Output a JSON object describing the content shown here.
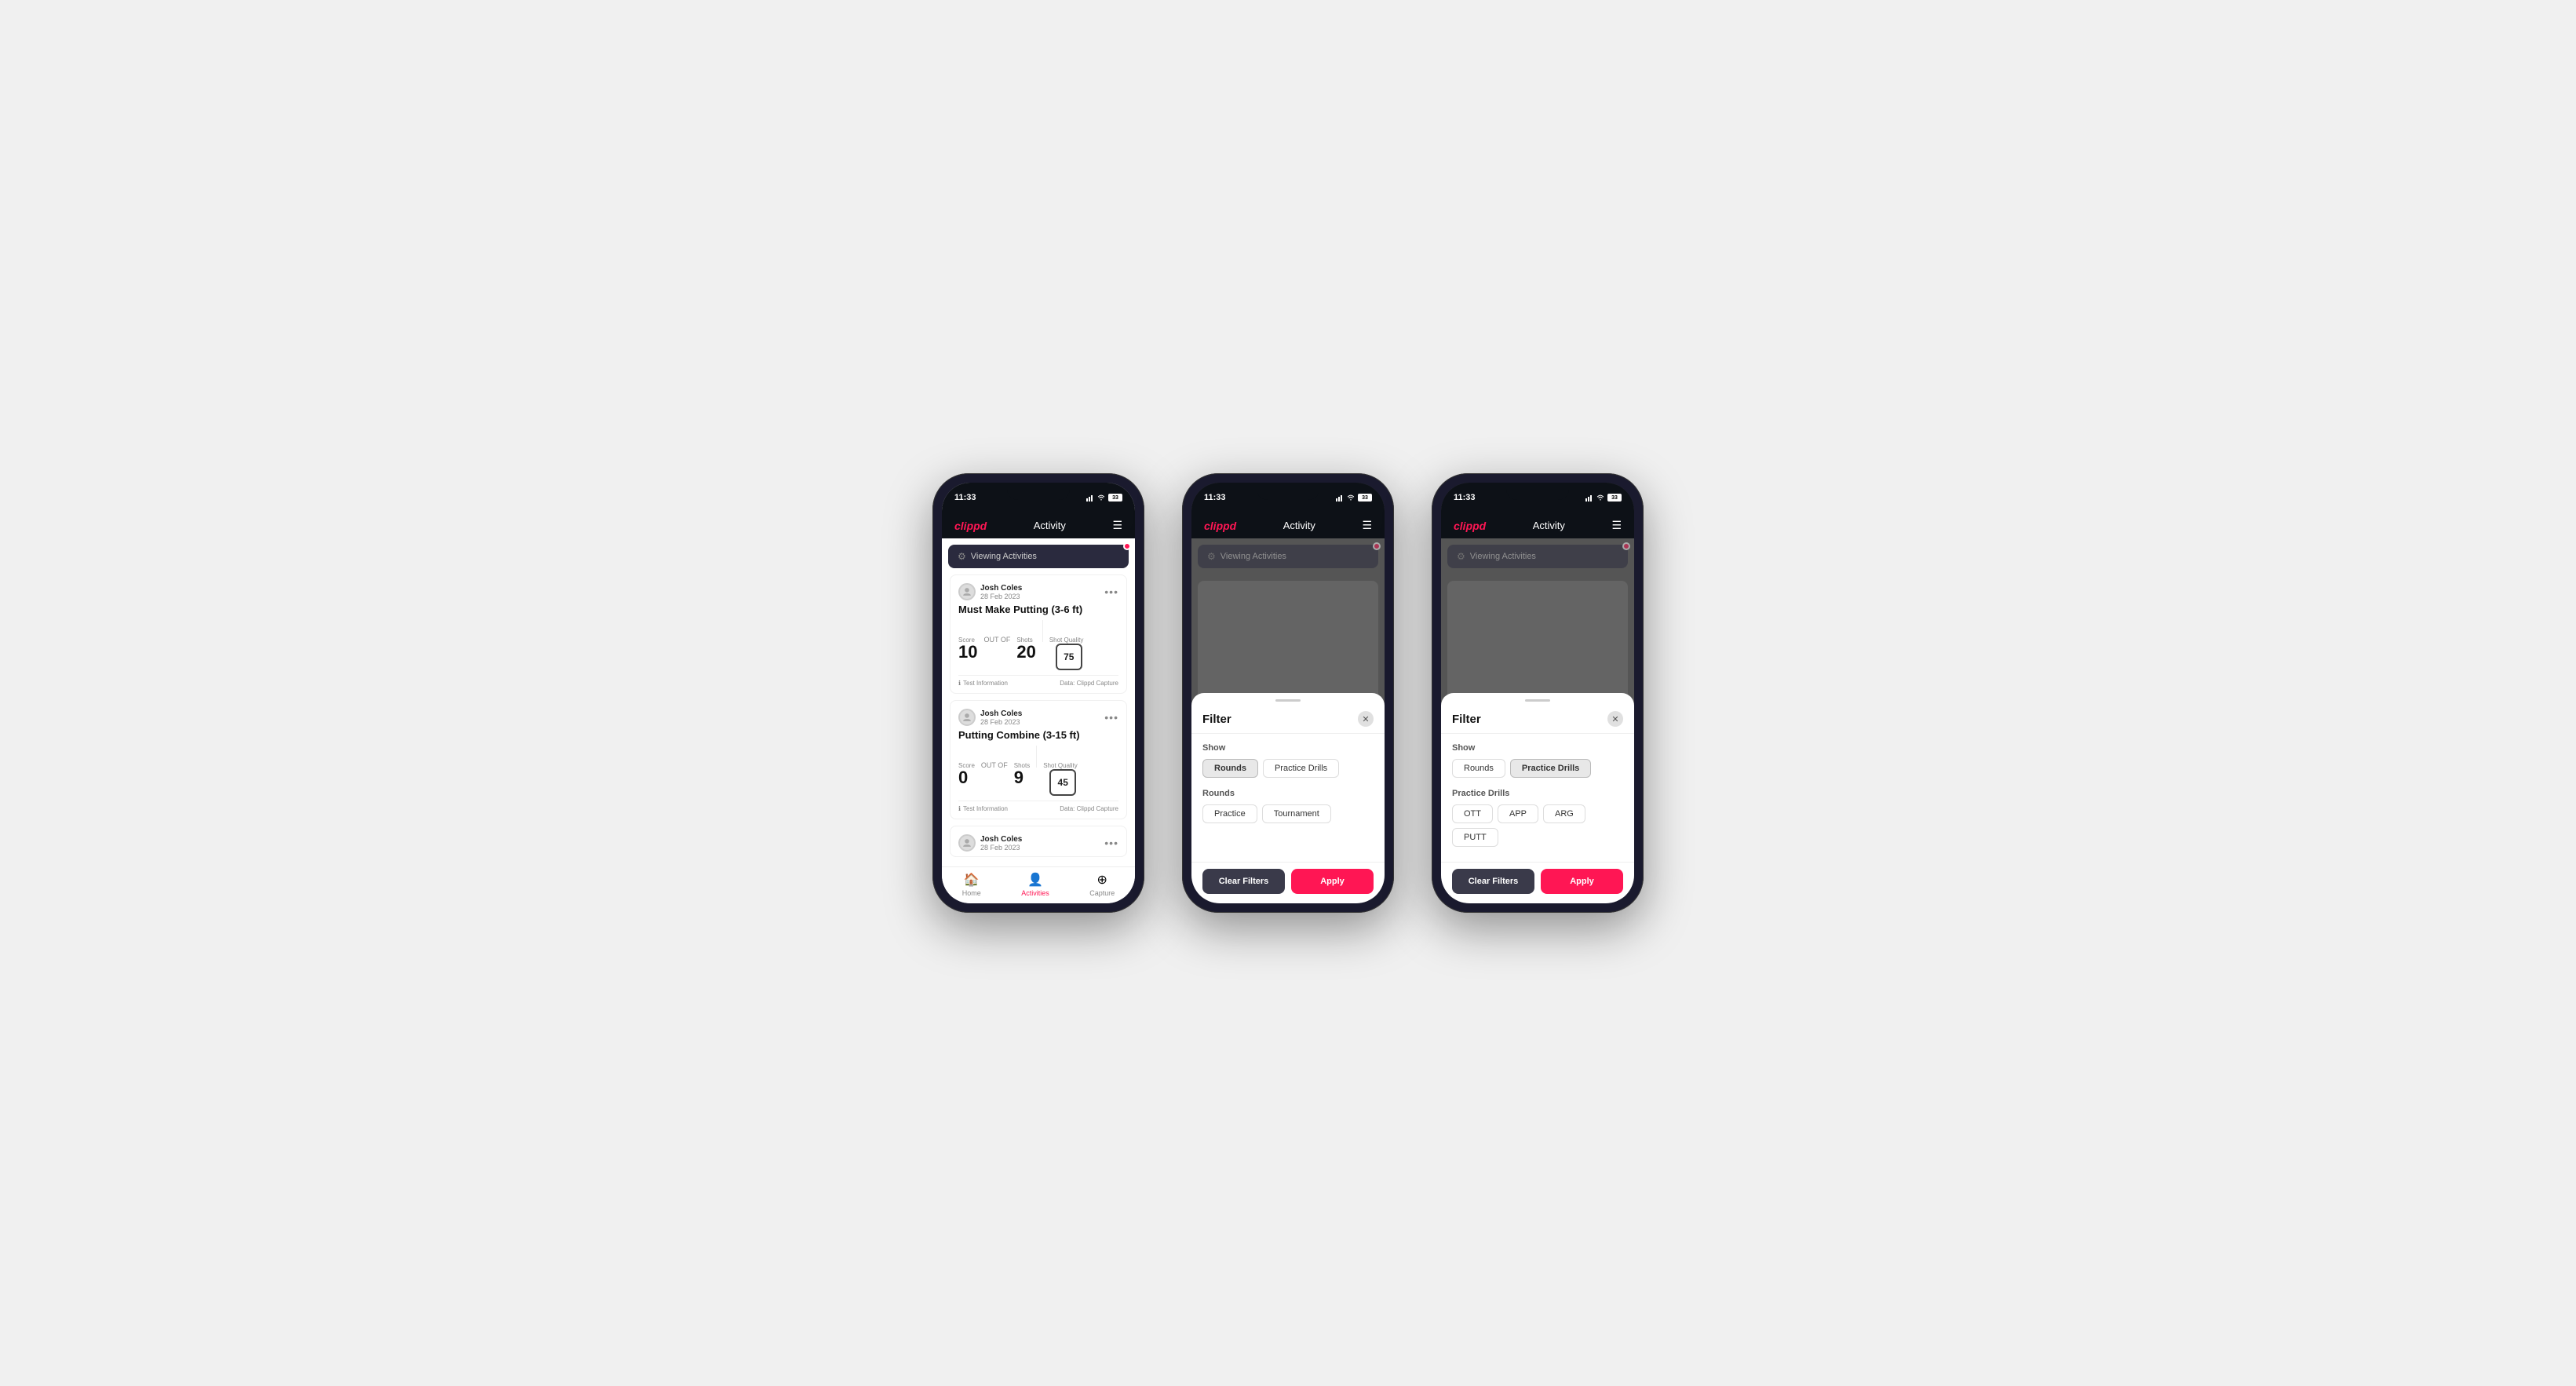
{
  "app": {
    "logo": "clippd",
    "nav_title": "Activity",
    "time": "11:33"
  },
  "viewing_banner": {
    "text": "Viewing Activities"
  },
  "activities": [
    {
      "user_name": "Josh Coles",
      "user_date": "28 Feb 2023",
      "title": "Must Make Putting (3-6 ft)",
      "score_label": "Score",
      "score_value": "10",
      "shots_label": "Shots",
      "shots_value": "20",
      "shot_quality_label": "Shot Quality",
      "shot_quality_value": "75",
      "out_of": "OUT OF",
      "footer_info": "Test Information",
      "footer_data": "Data: Clippd Capture"
    },
    {
      "user_name": "Josh Coles",
      "user_date": "28 Feb 2023",
      "title": "Putting Combine (3-15 ft)",
      "score_label": "Score",
      "score_value": "0",
      "shots_label": "Shots",
      "shots_value": "9",
      "shot_quality_label": "Shot Quality",
      "shot_quality_value": "45",
      "out_of": "OUT OF",
      "footer_info": "Test Information",
      "footer_data": "Data: Clippd Capture"
    },
    {
      "user_name": "Josh Coles",
      "user_date": "28 Feb 2023",
      "title": "",
      "score_label": "",
      "score_value": "",
      "shots_label": "",
      "shots_value": "",
      "shot_quality_label": "",
      "shot_quality_value": "",
      "out_of": "",
      "footer_info": "",
      "footer_data": ""
    }
  ],
  "bottom_nav": {
    "home_label": "Home",
    "activities_label": "Activities",
    "capture_label": "Capture"
  },
  "filter_modal": {
    "title": "Filter",
    "show_label": "Show",
    "rounds_chip": "Rounds",
    "practice_drills_chip": "Practice Drills",
    "rounds_section_label": "Rounds",
    "practice_label": "Practice",
    "tournament_label": "Tournament",
    "practice_drills_section_label": "Practice Drills",
    "ott_chip": "OTT",
    "app_chip": "APP",
    "arg_chip": "ARG",
    "putt_chip": "PUTT",
    "clear_filters_label": "Clear Filters",
    "apply_label": "Apply"
  }
}
